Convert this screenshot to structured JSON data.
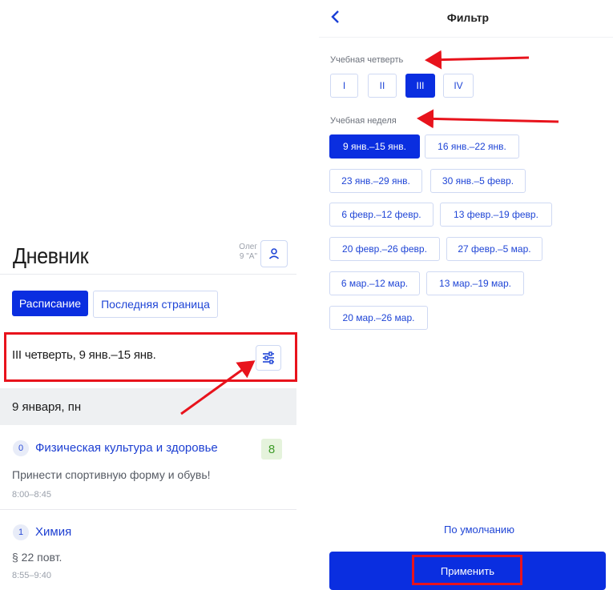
{
  "diary": {
    "title": "Дневник",
    "user_name": "Олег",
    "user_class": "9 \"А\"",
    "tabs": [
      {
        "label": "Расписание",
        "active": true
      },
      {
        "label": "Последняя страница",
        "active": false
      }
    ],
    "period_text": "III четверть, 9 янв.–15 янв.",
    "day_header": "9 января, пн",
    "lessons": [
      {
        "num": "0",
        "name": "Физическая культура и здоровье",
        "grade": "8",
        "homework": "Принести спортивную форму и обувь!",
        "time": "8:00–8:45"
      },
      {
        "num": "1",
        "name": "Химия",
        "homework": "§ 22 повт.",
        "time": "8:55–9:40"
      }
    ]
  },
  "filter": {
    "title": "Фильтр",
    "quarter_label": "Учебная четверть",
    "quarters": [
      {
        "label": "I",
        "active": false
      },
      {
        "label": "II",
        "active": false
      },
      {
        "label": "III",
        "active": true
      },
      {
        "label": "IV",
        "active": false
      }
    ],
    "week_label": "Учебная неделя",
    "weeks": [
      {
        "label": "9 янв.–15 янв.",
        "active": true
      },
      {
        "label": "16 янв.–22 янв.",
        "active": false
      },
      {
        "label": "23 янв.–29 янв.",
        "active": false
      },
      {
        "label": "30 янв.–5 февр.",
        "active": false
      },
      {
        "label": "6 февр.–12 февр.",
        "active": false
      },
      {
        "label": "13 февр.–19 февр.",
        "active": false
      },
      {
        "label": "20 февр.–26 февр.",
        "active": false
      },
      {
        "label": "27 февр.–5 мар.",
        "active": false
      },
      {
        "label": "6 мар.–12 мар.",
        "active": false
      },
      {
        "label": "13 мар.–19 мар.",
        "active": false
      },
      {
        "label": "20 мар.–26 мар.",
        "active": false
      }
    ],
    "default_link": "По умолчанию",
    "apply_label": "Применить"
  },
  "colors": {
    "accent": "#0a2ee0",
    "annotation_red": "#e8131c",
    "grade_green": "#3f9c2a"
  },
  "icons": {
    "user": "user-icon",
    "filter": "sliders-icon",
    "back": "chevron-left-icon"
  }
}
